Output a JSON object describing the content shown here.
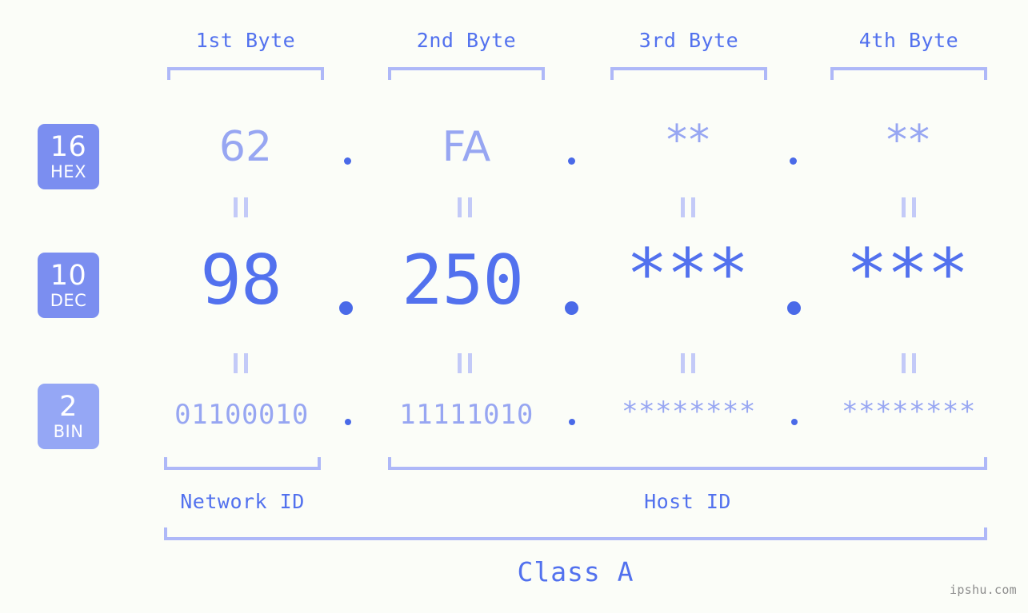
{
  "headers": [
    {
      "label": "1st Byte"
    },
    {
      "label": "2nd Byte"
    },
    {
      "label": "3rd Byte"
    },
    {
      "label": "4th Byte"
    }
  ],
  "radix_badges": [
    {
      "num": "16",
      "unit": "HEX",
      "color": "#7b8ef0"
    },
    {
      "num": "10",
      "unit": "DEC",
      "color": "#7b8ef0"
    },
    {
      "num": "2",
      "unit": "BIN",
      "color": "#95a7f5"
    }
  ],
  "rows": {
    "hex": {
      "values": [
        "62",
        "FA",
        "**",
        "**"
      ]
    },
    "dec": {
      "values": [
        "98",
        "250",
        "***",
        "***"
      ]
    },
    "bin": {
      "values": [
        "01100010",
        "11111010",
        "********",
        "********"
      ]
    }
  },
  "separators": {
    "dot": "."
  },
  "equality": {
    "glyph": "||"
  },
  "sections": [
    {
      "label": "Network ID"
    },
    {
      "label": "Host ID"
    }
  ],
  "class": {
    "label": "Class A"
  },
  "watermark": {
    "text": "ipshu.com"
  },
  "colors": {
    "background": "#fbfdf8",
    "accent_strong": "#5271ee",
    "accent_light": "#97a6f2",
    "bracket": "#aeb8f8",
    "badge": "#7b8ef0",
    "badge_light": "#95a7f5",
    "watermark": "#8d8d8d"
  }
}
